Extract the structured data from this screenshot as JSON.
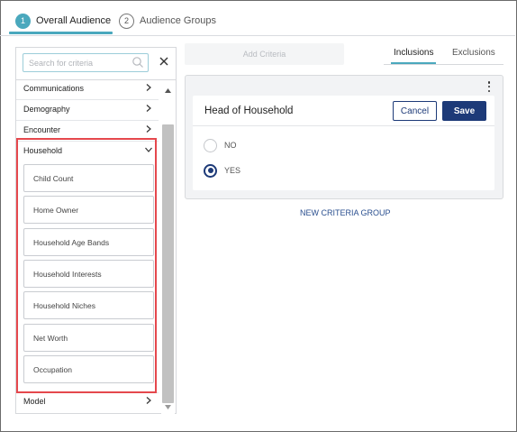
{
  "steps": [
    {
      "number": "1",
      "label": "Overall Audience"
    },
    {
      "number": "2",
      "label": "Audience Groups"
    }
  ],
  "left_panel": {
    "search_placeholder": "Search for criteria",
    "categories": [
      {
        "label": "Communications"
      },
      {
        "label": "Demography"
      },
      {
        "label": "Encounter"
      },
      {
        "label": "Household",
        "expanded": true
      },
      {
        "label": "Model"
      }
    ],
    "household_items": [
      "Child Count",
      "Home Owner",
      "Household Age Bands",
      "Household Interests",
      "Household Niches",
      "Net Worth",
      "Occupation"
    ]
  },
  "toolbar": {
    "add_criteria_label": "Add Criteria",
    "tabs": [
      {
        "label": "Inclusions",
        "active": true
      },
      {
        "label": "Exclusions",
        "active": false
      }
    ]
  },
  "criteria_card": {
    "title": "Head of Household",
    "cancel_label": "Cancel",
    "save_label": "Save",
    "options": [
      {
        "label": "NO",
        "selected": false
      },
      {
        "label": "YES",
        "selected": true
      }
    ]
  },
  "new_criteria_group_label": "NEW CRITERIA GROUP",
  "colors": {
    "accent_teal": "#4aa8bd",
    "primary_navy": "#1d3a78",
    "highlight_red": "#e5484d"
  }
}
